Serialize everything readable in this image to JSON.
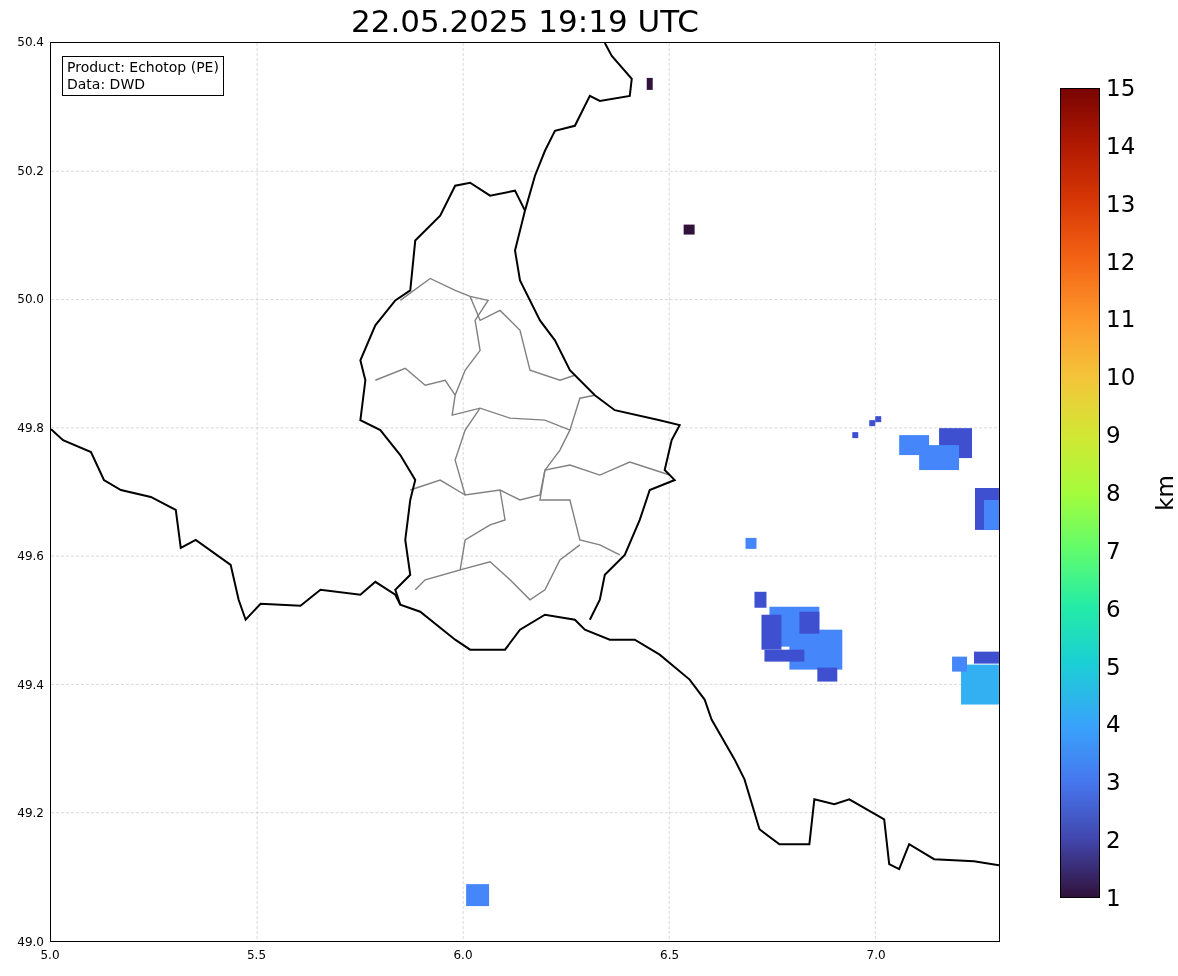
{
  "title": "22.05.2025 19:19 UTC",
  "info_box": [
    "Product: Echotop (PE)",
    "Data: DWD"
  ],
  "map": {
    "x_tick_labels": [
      "5.0",
      "5.5",
      "6.0",
      "6.5",
      "7.0"
    ],
    "y_tick_labels": [
      "50.4",
      "50.2",
      "50.0",
      "49.8",
      "49.6",
      "49.4",
      "49.2",
      "49.0"
    ]
  },
  "colorbar": {
    "tick_labels": [
      "15",
      "14",
      "13",
      "12",
      "11",
      "10",
      "9",
      "8",
      "7",
      "6",
      "5",
      "4",
      "3",
      "2",
      "1"
    ],
    "label": "km"
  }
}
